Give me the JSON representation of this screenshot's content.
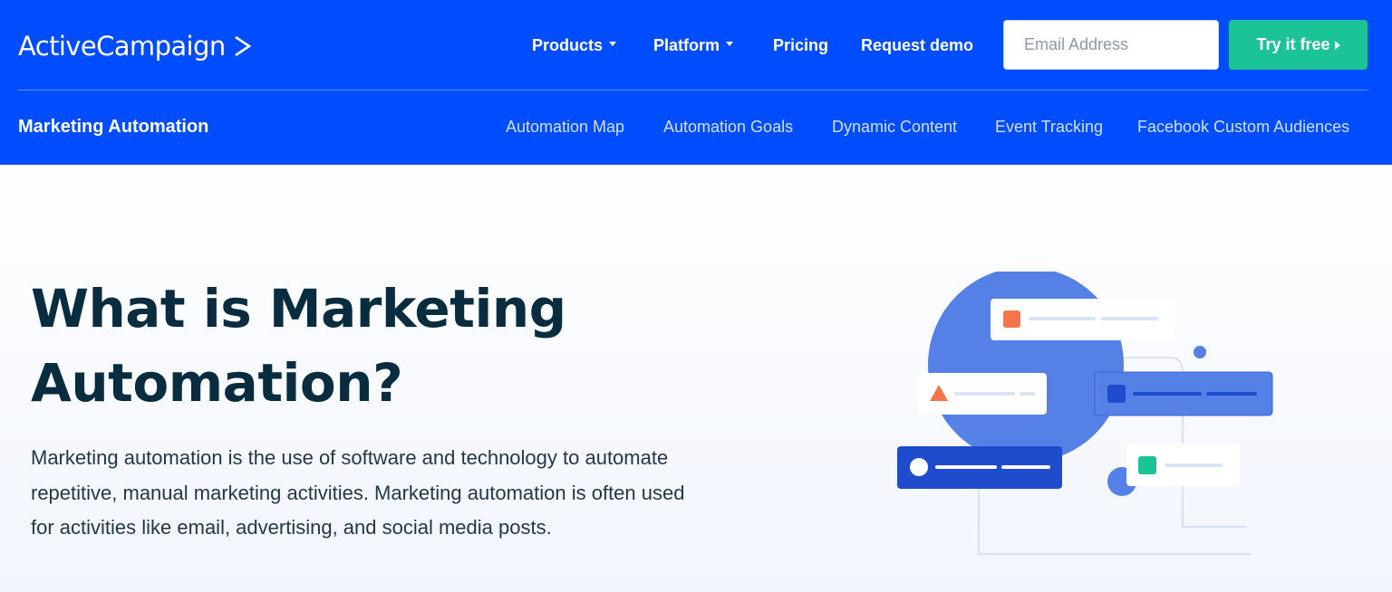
{
  "brand": {
    "name": "ActiveCampaign"
  },
  "topnav": {
    "products": "Products",
    "platform": "Platform",
    "pricing": "Pricing",
    "request_demo": "Request demo",
    "email_placeholder": "Email Address",
    "try_free": "Try it free"
  },
  "subnav": {
    "section_title": "Marketing Automation",
    "items": [
      "Automation Map",
      "Automation Goals",
      "Dynamic Content",
      "Event Tracking",
      "Facebook Custom Audiences"
    ]
  },
  "hero": {
    "title_line1": "What is Marketing",
    "title_line2": "Automation?",
    "description_line1": "Marketing automation is the use of software and technology to automate",
    "description_line2": "repetitive, manual marketing activities. Marketing automation is often used",
    "description_line3": "for activities like email, advertising, and social media posts."
  },
  "colors": {
    "header_bg": "#004cff",
    "cta_green": "#1cc397",
    "title_dark": "#0a2c3f",
    "illustration_blue": "#5580e6",
    "accent_orange": "#f4754c"
  },
  "icons": [
    "caret-down-icon",
    "caret-right-icon",
    "logo-chevron-icon"
  ]
}
